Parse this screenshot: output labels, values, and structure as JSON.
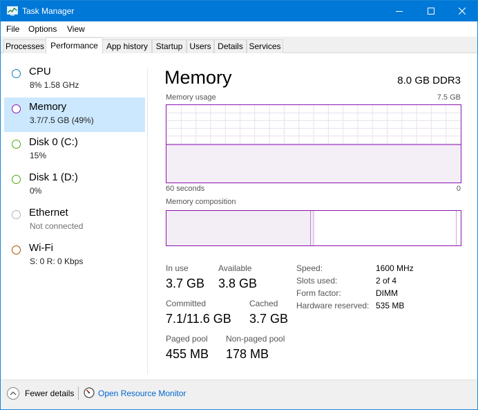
{
  "window": {
    "title": "Task Manager"
  },
  "menu": [
    "File",
    "Options",
    "View"
  ],
  "tabs": [
    "Processes",
    "Performance",
    "App history",
    "Startup",
    "Users",
    "Details",
    "Services"
  ],
  "active_tab": "Performance",
  "sidebar": [
    {
      "name": "CPU",
      "sub": "8%  1.58 GHz",
      "color": "#117dbb"
    },
    {
      "name": "Memory",
      "sub": "3.7/7.5 GB (49%)",
      "color": "#8b12ae"
    },
    {
      "name": "Disk 0 (C:)",
      "sub": "15%",
      "color": "#4da60c"
    },
    {
      "name": "Disk 1 (D:)",
      "sub": "0%",
      "color": "#4da60c"
    },
    {
      "name": "Ethernet",
      "sub": "Not connected",
      "color": "#a0a0a0"
    },
    {
      "name": "Wi-Fi",
      "sub": "S: 0 R: 0 Kbps",
      "color": "#a74f01"
    }
  ],
  "memory": {
    "title": "Memory",
    "spec": "8.0 GB DDR3",
    "usage_label": "Memory usage",
    "usage_max": "7.5 GB",
    "time_label": "60 seconds",
    "time_end": "0",
    "usage_fraction": 0.49,
    "composition_label": "Memory composition",
    "composition": {
      "in_use": 0.49,
      "modified": 0.01,
      "standby": 0.485,
      "free": 0.015
    },
    "stats": {
      "in_use_label": "In use",
      "in_use": "3.7 GB",
      "available_label": "Available",
      "available": "3.8 GB",
      "committed_label": "Committed",
      "committed": "7.1/11.6 GB",
      "cached_label": "Cached",
      "cached": "3.7 GB",
      "paged_label": "Paged pool",
      "paged": "455 MB",
      "nonpaged_label": "Non-paged pool",
      "nonpaged": "178 MB"
    },
    "details": [
      {
        "k": "Speed:",
        "v": "1600 MHz"
      },
      {
        "k": "Slots used:",
        "v": "2 of 4"
      },
      {
        "k": "Form factor:",
        "v": "DIMM"
      },
      {
        "k": "Hardware reserved:",
        "v": "535 MB"
      }
    ]
  },
  "footer": {
    "fewer": "Fewer details",
    "resource": "Open Resource Monitor"
  },
  "colors": {
    "accent": "#0078d7",
    "memory": "#8b12ae",
    "link": "#0066cc",
    "selected": "#cce8ff"
  }
}
